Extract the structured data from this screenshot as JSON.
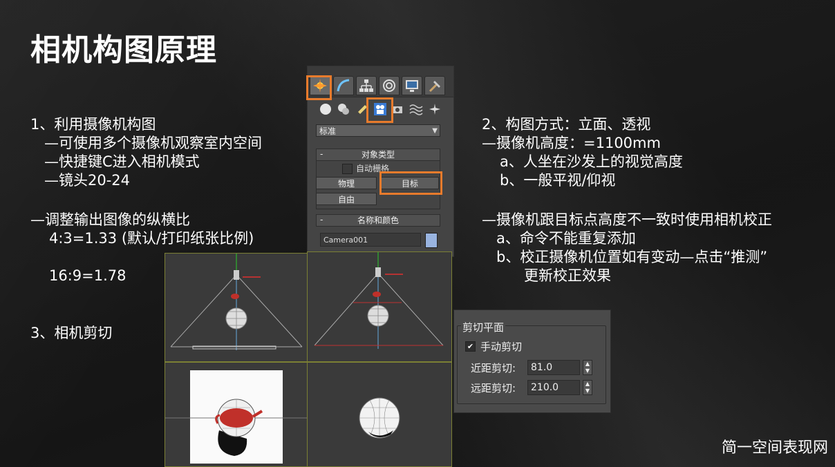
{
  "title": "相机构图原理",
  "left_text": {
    "line1": "1、利用摄像机构图",
    "line2": "—可使用多个摄像机观察室内空间",
    "line3": "—快捷键C进入相机模式",
    "line4": "—镜头20-24",
    "line5": "—调整输出图像的纵横比",
    "line6": "4:3=1.33 (默认/打印纸张比例)",
    "line7": "16:9=1.78",
    "line8": "3、相机剪切"
  },
  "right_text": {
    "line1": "2、构图方式：立面、透视",
    "line2": "—摄像机高度：=1100mm",
    "line3": "a、人坐在沙发上的视觉高度",
    "line4": "b、一般平视/仰视",
    "line5": "—摄像机跟目标点高度不一致时使用相机校正",
    "line6": "a、命令不能重复添加",
    "line7": "b、校正摄像机位置如有变动—点击“推测”",
    "line8": "更新校正效果"
  },
  "panel": {
    "dropdown_value": "标准",
    "rollout1_title": "对象类型",
    "autogrid_label": "自动栅格",
    "btn_physical": "物理",
    "btn_target": "目标",
    "btn_free": "自由",
    "rollout2_title": "名称和颜色",
    "name_value": "Camera001",
    "minus": "-"
  },
  "clipping": {
    "title": "剪切平面",
    "manual_label": "手动剪切",
    "check_mark": "✔",
    "near_label": "近距剪切:",
    "near_value": "81.0",
    "far_label": "远距剪切:",
    "far_value": "210.0",
    "up": "▲",
    "down": "▼"
  },
  "watermark": "简一空间表现网",
  "colors": {
    "highlight": "#e87b2c",
    "viewport_border": "#7b7f34",
    "teapot": "#c0302a"
  }
}
